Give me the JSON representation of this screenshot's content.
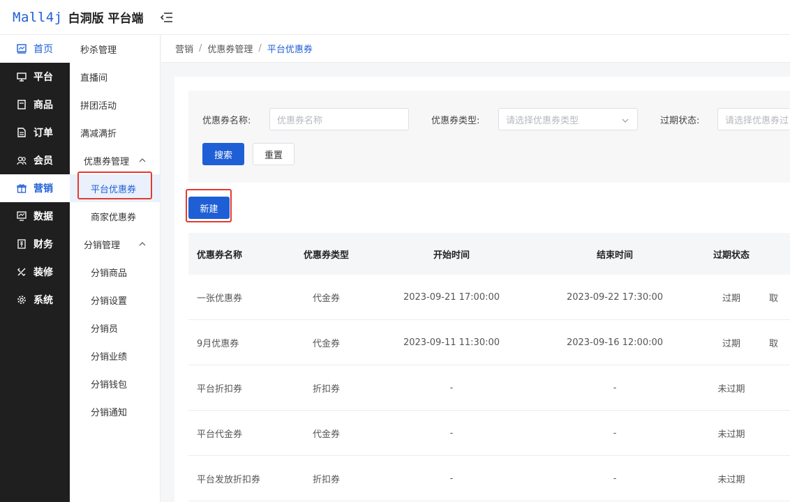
{
  "header": {
    "logo": "Mall4j",
    "title": "白洞版 平台端"
  },
  "primary_nav": [
    {
      "label": "首页",
      "icon": "dashboard-icon"
    },
    {
      "label": "平台",
      "icon": "monitor-icon"
    },
    {
      "label": "商品",
      "icon": "product-icon"
    },
    {
      "label": "订单",
      "icon": "order-icon"
    },
    {
      "label": "会员",
      "icon": "member-icon"
    },
    {
      "label": "营销",
      "icon": "gift-icon",
      "active": true
    },
    {
      "label": "数据",
      "icon": "data-icon"
    },
    {
      "label": "财务",
      "icon": "finance-icon"
    },
    {
      "label": "装修",
      "icon": "decorate-icon"
    },
    {
      "label": "系统",
      "icon": "gear-icon"
    }
  ],
  "secondary_nav": {
    "top_items": [
      "秒杀管理",
      "直播间",
      "拼团活动",
      "满减满折"
    ],
    "coupon_group": "优惠券管理",
    "coupon_items": [
      "平台优惠券",
      "商家优惠券"
    ],
    "dist_group": "分销管理",
    "dist_items": [
      "分销商品",
      "分销设置",
      "分销员",
      "分销业绩",
      "分销钱包",
      "分销通知"
    ]
  },
  "breadcrumb": {
    "level1": "营销",
    "level2": "优惠券管理",
    "current": "平台优惠券",
    "sep": "/"
  },
  "search": {
    "name_label": "优惠券名称:",
    "name_placeholder": "优惠券名称",
    "type_label": "优惠券类型:",
    "type_placeholder": "请选择优惠券类型",
    "status_label": "过期状态:",
    "status_placeholder": "请选择优惠券过",
    "search_btn": "搜索",
    "reset_btn": "重置"
  },
  "actions": {
    "new_btn": "新建"
  },
  "table": {
    "headers": [
      "优惠券名称",
      "优惠券类型",
      "开始时间",
      "结束时间",
      "过期状态"
    ],
    "rows": [
      {
        "name": "一张优惠券",
        "type": "代金券",
        "start": "2023-09-21 17:00:00",
        "end": "2023-09-22 17:30:00",
        "status": "过期",
        "extra": "取"
      },
      {
        "name": "9月优惠券",
        "type": "代金券",
        "start": "2023-09-11 11:30:00",
        "end": "2023-09-16 12:00:00",
        "status": "过期",
        "extra": "取"
      },
      {
        "name": "平台折扣券",
        "type": "折扣券",
        "start": "-",
        "end": "-",
        "status": "未过期",
        "extra": ""
      },
      {
        "name": "平台代金券",
        "type": "代金券",
        "start": "-",
        "end": "-",
        "status": "未过期",
        "extra": ""
      },
      {
        "name": "平台发放折扣券",
        "type": "折扣券",
        "start": "-",
        "end": "-",
        "status": "未过期",
        "extra": ""
      }
    ]
  },
  "colors": {
    "brand": "#1f5fd6",
    "highlight": "#e23b2e",
    "sidebar_bg": "#1f1f1f"
  }
}
